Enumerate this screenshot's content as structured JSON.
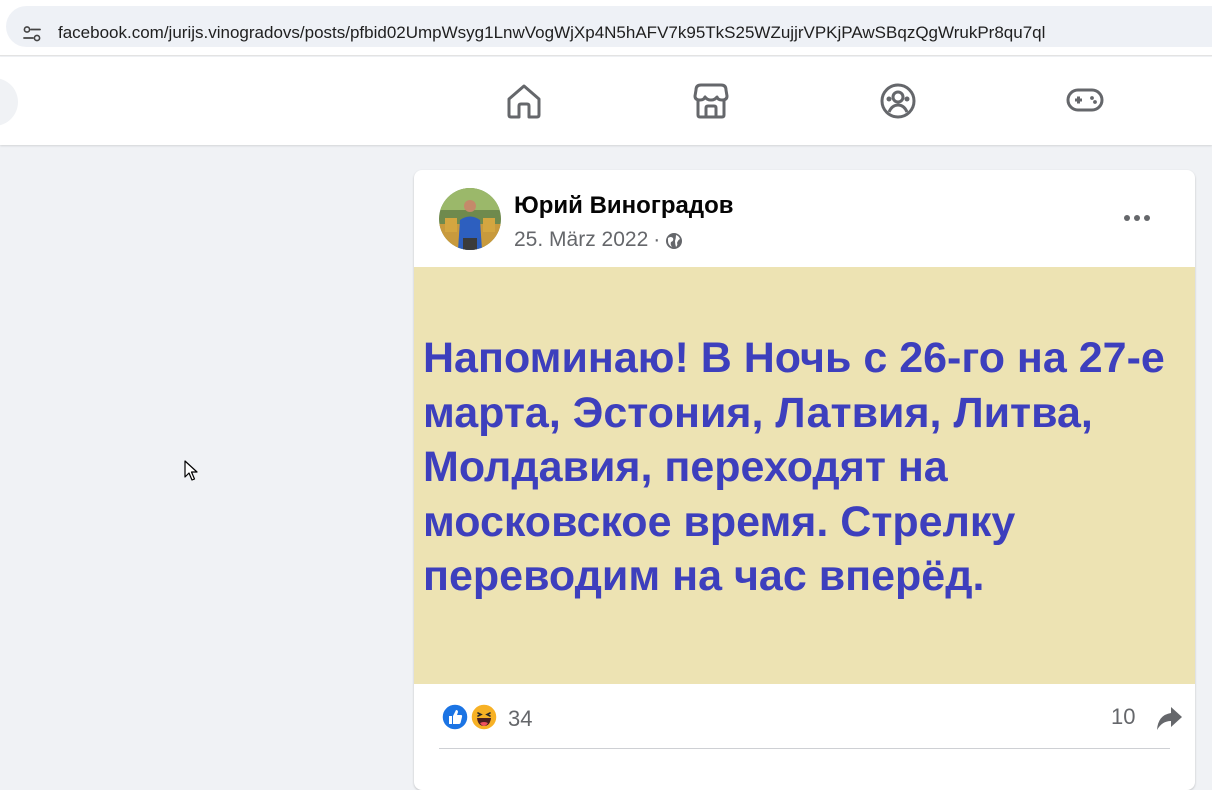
{
  "browser": {
    "url": "facebook.com/jurijs.vinogradovs/posts/pfbid02UmpWsyg1LnwVogWjXp4N5hAFV7k95TkS25WZujjrVPKjPAwSBqzQgWrukPr8qu7ql"
  },
  "nav": {
    "icons": [
      "home-icon",
      "marketplace-icon",
      "groups-icon",
      "gaming-icon"
    ]
  },
  "post": {
    "author": "Юрий Виноградов",
    "date": "25. März 2022",
    "separator": "·",
    "privacy_icon": "globe-icon",
    "text": "Напоминаю! В Ночь с 26-го на 27-е марта, Эстония, Латвия, Литва, Молдавия, переходят на московское время. Стрелку переводим на час вперёд.",
    "background_color": "#ede3b3",
    "text_color": "#3d3fbd",
    "reactions": [
      "like",
      "haha"
    ],
    "reaction_count": "34",
    "share_count": "10"
  }
}
